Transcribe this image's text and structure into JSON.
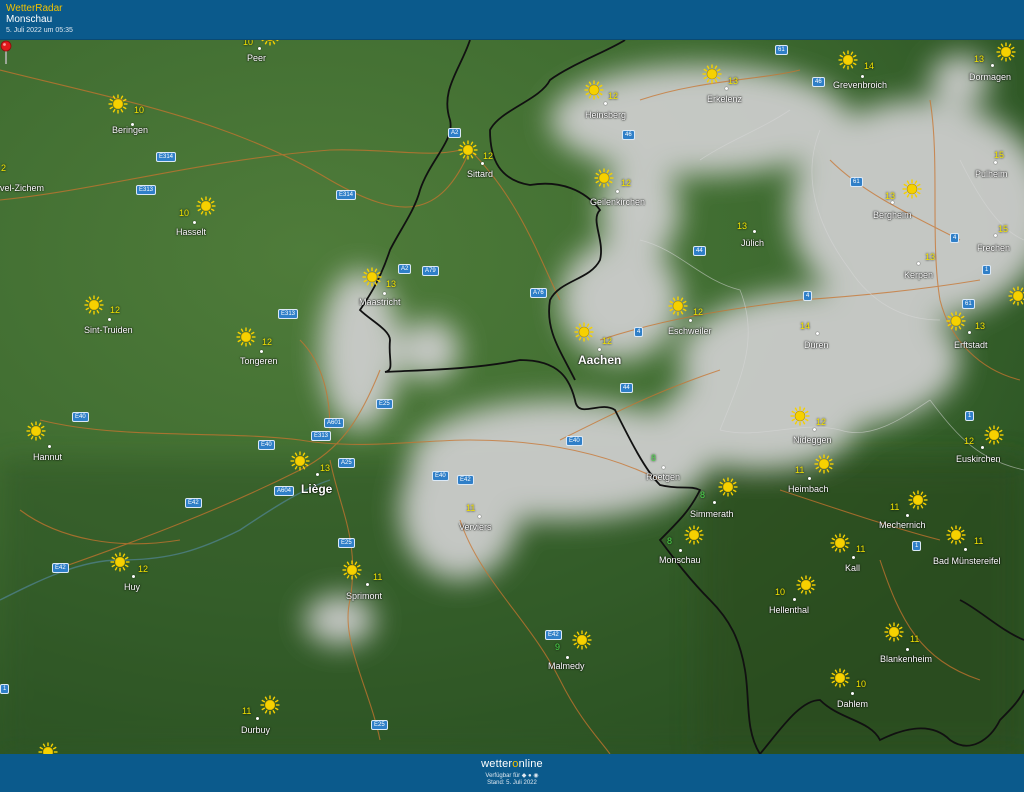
{
  "header": {
    "app_title": "WetterRadar",
    "location": "Monschau",
    "timestamp": "5. Juli 2022 um 05:35"
  },
  "footer": {
    "brand_left": "wetter",
    "brand_o": "o",
    "brand_right": "nline",
    "available": "Verfügbar für",
    "stand": "Stand: 5. Juli 2022"
  },
  "colors": {
    "bar": "#0b5a8c",
    "land": "#3e6b30",
    "cloud": "#c9c9c9",
    "temp": "#f2e200",
    "temp_green": "#4cd94c",
    "road": "#c8742f",
    "border": "#1a1a1a"
  },
  "towns": [
    {
      "name": "Peer"
    },
    {
      "name": "Beringen"
    },
    {
      "name": "vel-Zichem"
    },
    {
      "name": "Hasselt"
    },
    {
      "name": "Sint-Truiden"
    },
    {
      "name": "Tongeren"
    },
    {
      "name": "Hannut"
    },
    {
      "name": "Liège"
    },
    {
      "name": "Huy"
    },
    {
      "name": "Sprimont"
    },
    {
      "name": "Durbuy"
    },
    {
      "name": "Verviers"
    },
    {
      "name": "Malmedy"
    },
    {
      "name": "Maastricht"
    },
    {
      "name": "Sittard"
    },
    {
      "name": "Heinsberg"
    },
    {
      "name": "Geilenkirchen"
    },
    {
      "name": "Erkelenz"
    },
    {
      "name": "Aachen"
    },
    {
      "name": "Roetgen"
    },
    {
      "name": "Monschau"
    },
    {
      "name": "Simmerath"
    },
    {
      "name": "Eschweiler"
    },
    {
      "name": "Jülich"
    },
    {
      "name": "Grevenbroich"
    },
    {
      "name": "Dormagen"
    },
    {
      "name": "Bergheim"
    },
    {
      "name": "Pulheim"
    },
    {
      "name": "Frechen"
    },
    {
      "name": "Kerpen"
    },
    {
      "name": "Düren"
    },
    {
      "name": "Erftstadt"
    },
    {
      "name": "Nideggen"
    },
    {
      "name": "Heimbach"
    },
    {
      "name": "Euskirchen"
    },
    {
      "name": "Mechernich"
    },
    {
      "name": "Kall"
    },
    {
      "name": "Bad Münstereifel"
    },
    {
      "name": "Hellenthal"
    },
    {
      "name": "Blankenheim"
    },
    {
      "name": "Dahlem"
    }
  ],
  "temps": [
    {
      "value": "10"
    },
    {
      "value": "2"
    },
    {
      "value": "10"
    },
    {
      "value": "10"
    },
    {
      "value": "12"
    },
    {
      "value": "12"
    },
    {
      "value": "13"
    },
    {
      "value": "12"
    },
    {
      "value": "11"
    },
    {
      "value": "11"
    },
    {
      "value": "11"
    },
    {
      "value": "9",
      "color": "green"
    },
    {
      "value": "13"
    },
    {
      "value": "12"
    },
    {
      "value": "12"
    },
    {
      "value": "12"
    },
    {
      "value": "13"
    },
    {
      "value": "12"
    },
    {
      "value": "8",
      "color": "green"
    },
    {
      "value": "8",
      "color": "green"
    },
    {
      "value": "8",
      "color": "green"
    },
    {
      "value": "12"
    },
    {
      "value": "13"
    },
    {
      "value": "14"
    },
    {
      "value": "13"
    },
    {
      "value": "13"
    },
    {
      "value": "15"
    },
    {
      "value": "15"
    },
    {
      "value": "13"
    },
    {
      "value": "14"
    },
    {
      "value": "13"
    },
    {
      "value": "12"
    },
    {
      "value": "11"
    },
    {
      "value": "12"
    },
    {
      "value": "11"
    },
    {
      "value": "11"
    },
    {
      "value": "11"
    },
    {
      "value": "10"
    },
    {
      "value": "11"
    },
    {
      "value": "10"
    }
  ],
  "roads": [
    {
      "label": "A2"
    },
    {
      "label": "E314"
    },
    {
      "label": "E313"
    },
    {
      "label": "E314"
    },
    {
      "label": "A2"
    },
    {
      "label": "A79"
    },
    {
      "label": "A76"
    },
    {
      "label": "E313"
    },
    {
      "label": "E25"
    },
    {
      "label": "A601"
    },
    {
      "label": "E313"
    },
    {
      "label": "E40"
    },
    {
      "label": "E40"
    },
    {
      "label": "A25"
    },
    {
      "label": "A604"
    },
    {
      "label": "E42"
    },
    {
      "label": "E42"
    },
    {
      "label": "E25"
    },
    {
      "label": "E40"
    },
    {
      "label": "E42"
    },
    {
      "label": "E40"
    },
    {
      "label": "44"
    },
    {
      "label": "4"
    },
    {
      "label": "44"
    },
    {
      "label": "46"
    },
    {
      "label": "61"
    },
    {
      "label": "46"
    },
    {
      "label": "61"
    },
    {
      "label": "4"
    },
    {
      "label": "4"
    },
    {
      "label": "1"
    },
    {
      "label": "61"
    },
    {
      "label": "1"
    },
    {
      "label": "1"
    },
    {
      "label": "E42"
    },
    {
      "label": "E25"
    },
    {
      "label": "1"
    }
  ]
}
